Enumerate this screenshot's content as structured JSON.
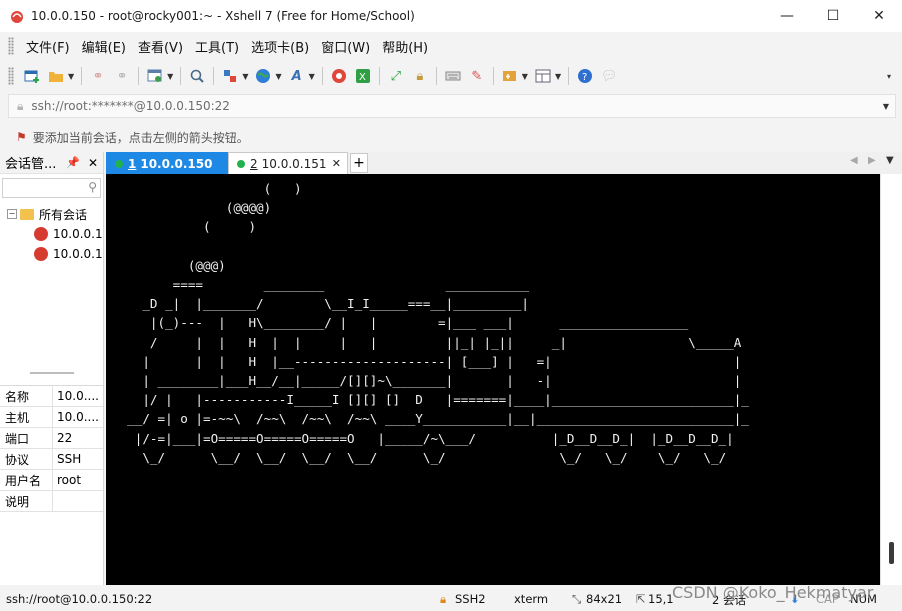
{
  "window": {
    "title": "10.0.0.150 - root@rocky001:~ - Xshell 7 (Free for Home/School)",
    "controls": {
      "minimize": "—",
      "maximize": "☐",
      "close": "✕"
    }
  },
  "menu": [
    "文件(F)",
    "编辑(E)",
    "查看(V)",
    "工具(T)",
    "选项卡(B)",
    "窗口(W)",
    "帮助(H)"
  ],
  "address": {
    "value": "ssh://root:*******@10.0.0.150:22"
  },
  "hint": {
    "text": "要添加当前会话，点击左侧的箭头按钮。"
  },
  "session_panel": {
    "title": "会话管...",
    "pin": "📌",
    "close": "✕",
    "tree": {
      "root": "所有会话",
      "items": [
        "10.0.0.1",
        "10.0.0.1"
      ]
    },
    "properties": [
      {
        "key": "名称",
        "value": "10.0...."
      },
      {
        "key": "主机",
        "value": "10.0...."
      },
      {
        "key": "端口",
        "value": "22"
      },
      {
        "key": "协议",
        "value": "SSH"
      },
      {
        "key": "用户名",
        "value": "root"
      },
      {
        "key": "说明",
        "value": ""
      }
    ]
  },
  "tabs": [
    {
      "number": "1",
      "label": "10.0.0.150",
      "active": true
    },
    {
      "number": "2",
      "label": "10.0.0.151",
      "active": false
    }
  ],
  "terminal": {
    "lines": [
      "                    (   )",
      "               (@@@@)",
      "            (     )",
      "",
      "          (@@@)",
      "        ====        ________                ___________",
      "    _D _|  |_______/        \\__I_I_____===__|_________|",
      "     |(_)---  |   H\\________/ |   |        =|___ ___|      _________________",
      "     /     |  |   H  |  |     |   |         ||_| |_||     _|                \\_____A",
      "    |      |  |   H  |__--------------------| [___] |   =|                        |",
      "    | ________|___H__/__|_____/[][]~\\_______|       |   -|                        |",
      "    |/ |   |-----------I_____I [][] []  D   |=======|____|________________________|_",
      "  __/ =| o |=-~~\\  /~~\\  /~~\\  /~~\\ ____Y___________|__|__________________________|_",
      "   |/-=|___|=O=====O=====O=====O   |_____/~\\___/          |_D__D__D_|  |_D__D__D_|",
      "    \\_/      \\__/  \\__/  \\__/  \\__/      \\_/               \\_/   \\_/    \\_/   \\_/"
    ]
  },
  "status": {
    "connection": "ssh://root@10.0.0.150:22",
    "protocol": "SSH2",
    "terminal_type": "xterm",
    "size": "84x21",
    "cursor": "15,1",
    "sessions": "2 会话",
    "caps": "CAP",
    "num": "NUM"
  },
  "watermark": "CSDN @Koko_Hekmatyar",
  "colors": {
    "tab_active": "#1e88e5",
    "terminal_bg": "#000000",
    "terminal_fg": "#f0f0f0",
    "connected_dot": "#23b14d",
    "session_icon": "#d63b30"
  },
  "icons": [
    "new-session-icon",
    "open-folder-icon",
    "reconnect-icon",
    "disconnect-icon",
    "properties-icon",
    "find-icon",
    "transfer-icon",
    "globe-icon",
    "font-icon",
    "xftp-icon",
    "xmanager-icon",
    "fullscreen-icon",
    "lock-icon",
    "keyboard-icon",
    "highlight-icon",
    "script-icon",
    "layout-icon",
    "help-icon",
    "chat-icon"
  ]
}
